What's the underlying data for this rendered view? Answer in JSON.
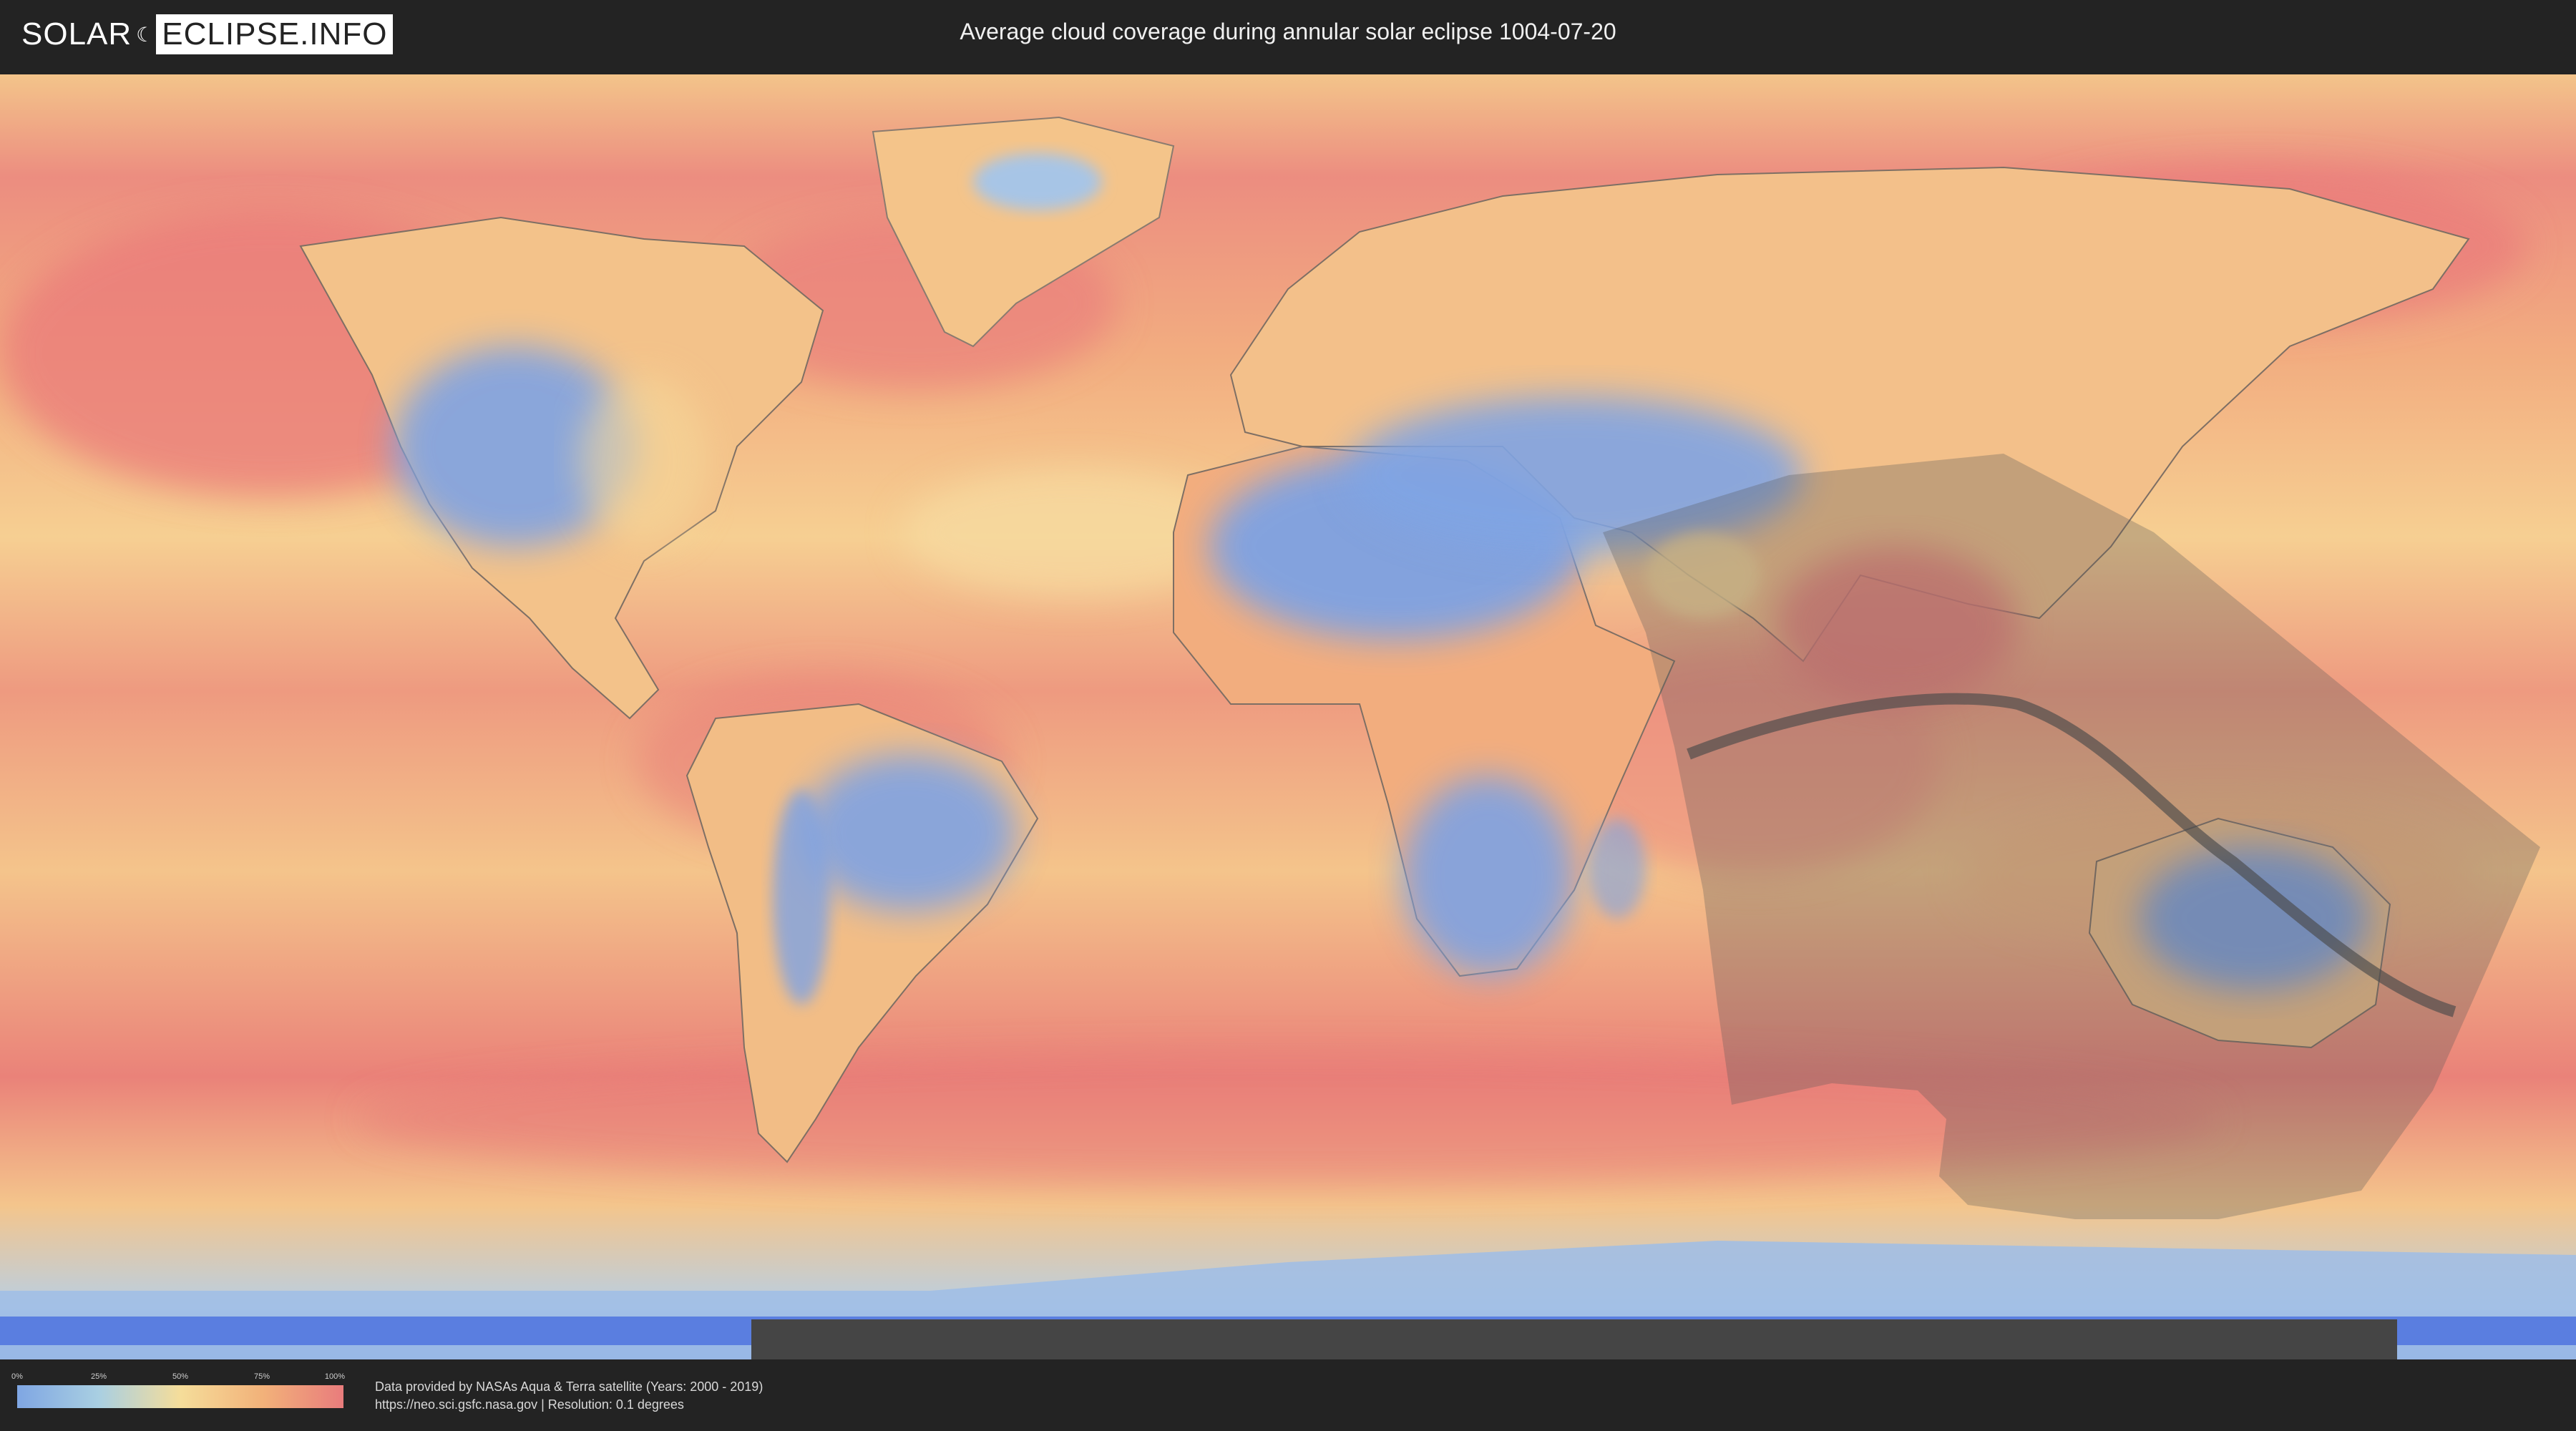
{
  "header": {
    "logo_left": "SOLAR",
    "logo_right": "ECLIPSE.INFO",
    "title": "Average cloud coverage during annular solar eclipse 1004-07-20"
  },
  "legend": {
    "ticks": [
      "0%",
      "25%",
      "50%",
      "75%",
      "100%"
    ],
    "colors": [
      "#7fa6e3",
      "#a9cfe2",
      "#f5dd9a",
      "#f2b27a",
      "#e97c7c"
    ]
  },
  "footer": {
    "credit_line1": "Data provided by NASAs Aqua & Terra satellite (Years: 2000 - 2019)",
    "credit_line2": "https://neo.sci.gsfc.nasa.gov | Resolution: 0.1 degrees"
  },
  "map": {
    "projection": "equirectangular",
    "colors": {
      "ocean_cloudy": "#ec8a7e",
      "mid_coverage": "#f4c98a",
      "low_coverage": "#8fb1e6",
      "clear": "#6f93e0",
      "eclipse_shadow": "#555555",
      "central_path": "#3f3f3f"
    }
  }
}
